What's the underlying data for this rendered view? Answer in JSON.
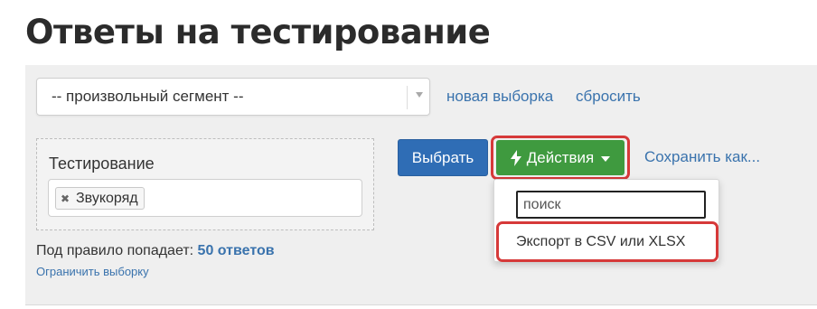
{
  "page": {
    "title": "Ответы на тестирование"
  },
  "segment": {
    "selected": "-- произвольный сегмент --",
    "new_selection_link": "новая выборка",
    "reset_link": "сбросить"
  },
  "rule": {
    "label": "Тестирование",
    "tags": [
      "Звукоряд"
    ],
    "count_prefix": "Под правило попадает:",
    "count_value": "50 ответов",
    "limit_link": "Ограничить выборку"
  },
  "toolbar": {
    "select_button": "Выбрать",
    "actions_button": "Действия",
    "save_as_link": "Сохранить как..."
  },
  "actions_menu": {
    "search_placeholder": "поиск",
    "items": [
      "Экспорт в CSV или XLSX"
    ]
  },
  "colors": {
    "primary_blue": "#2f6db5",
    "action_green": "#3f9a3f",
    "link_blue": "#3a73ad",
    "highlight_red": "#d63939"
  },
  "icons": {
    "actions": "lightning-bolt-icon",
    "tag_remove": "close-icon",
    "dropdown": "chevron-down-icon"
  }
}
